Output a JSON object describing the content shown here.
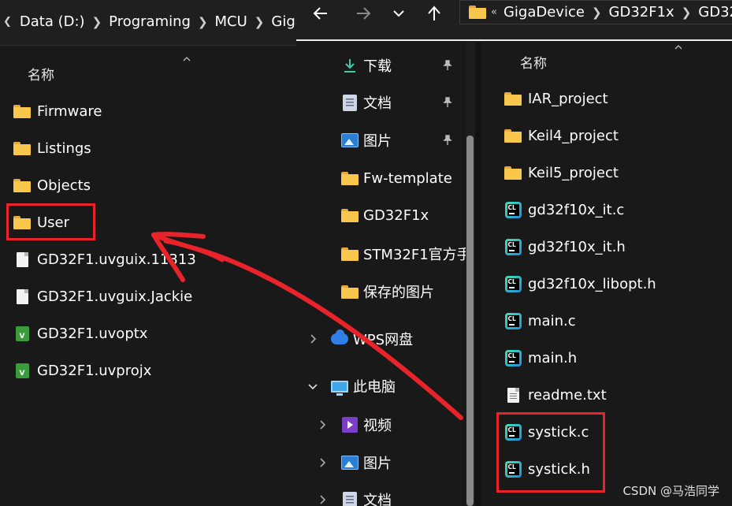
{
  "left_window": {
    "breadcrumbs": [
      "Data (D:)",
      "Programing",
      "MCU",
      "Giga"
    ],
    "column_name": "名称",
    "items": [
      {
        "name": "Firmware",
        "icon": "folder-icon"
      },
      {
        "name": "Listings",
        "icon": "folder-icon"
      },
      {
        "name": "Objects",
        "icon": "folder-icon"
      },
      {
        "name": "User",
        "icon": "folder-icon"
      },
      {
        "name": "GD32F1.uvguix.11313",
        "icon": "file-icon"
      },
      {
        "name": "GD32F1.uvguix.Jackie",
        "icon": "file-icon"
      },
      {
        "name": "GD32F1.uvoptx",
        "icon": "uvision-icon"
      },
      {
        "name": "GD32F1.uvprojx",
        "icon": "uvision-icon"
      }
    ]
  },
  "right_window": {
    "breadcrumbs": [
      "GigaDevice",
      "GD32F1x",
      "GD32"
    ],
    "nav_items": [
      {
        "label": "下载",
        "icon": "download-icon",
        "pinned": true
      },
      {
        "label": "文档",
        "icon": "documents-icon",
        "pinned": true
      },
      {
        "label": "图片",
        "icon": "pictures-icon",
        "pinned": true
      },
      {
        "label": "Fw-template",
        "icon": "folder-icon",
        "pinned": false
      },
      {
        "label": "GD32F1x",
        "icon": "folder-icon",
        "pinned": false
      },
      {
        "label": "STM32F1官方手",
        "icon": "folder-icon",
        "pinned": false
      },
      {
        "label": "保存的图片",
        "icon": "folder-icon",
        "pinned": false
      },
      {
        "label": "WPS网盘",
        "icon": "cloud-icon",
        "expand": "collapsed"
      },
      {
        "label": "此电脑",
        "icon": "computer-icon",
        "expand": "expanded"
      },
      {
        "label": "视频",
        "icon": "videos-icon",
        "expand": "collapsed"
      },
      {
        "label": "图片",
        "icon": "pictures-icon",
        "expand": "collapsed"
      },
      {
        "label": "文档",
        "icon": "documents-icon",
        "expand": "collapsed"
      }
    ],
    "column_name": "名称",
    "files": [
      {
        "name": "IAR_project",
        "icon": "folder-icon"
      },
      {
        "name": "Keil4_project",
        "icon": "folder-icon"
      },
      {
        "name": "Keil5_project",
        "icon": "folder-icon"
      },
      {
        "name": "gd32f10x_it.c",
        "icon": "clion-file-icon"
      },
      {
        "name": "gd32f10x_it.h",
        "icon": "clion-file-icon"
      },
      {
        "name": "gd32f10x_libopt.h",
        "icon": "clion-file-icon"
      },
      {
        "name": "main.c",
        "icon": "clion-file-icon"
      },
      {
        "name": "main.h",
        "icon": "clion-file-icon"
      },
      {
        "name": "readme.txt",
        "icon": "text-file-icon"
      },
      {
        "name": "systick.c",
        "icon": "clion-file-icon"
      },
      {
        "name": "systick.h",
        "icon": "clion-file-icon"
      }
    ]
  },
  "watermark": "CSDN @马浩同学",
  "colors": {
    "highlight": "#e8232a",
    "background": "#191919",
    "folder": "#f8c74b"
  }
}
